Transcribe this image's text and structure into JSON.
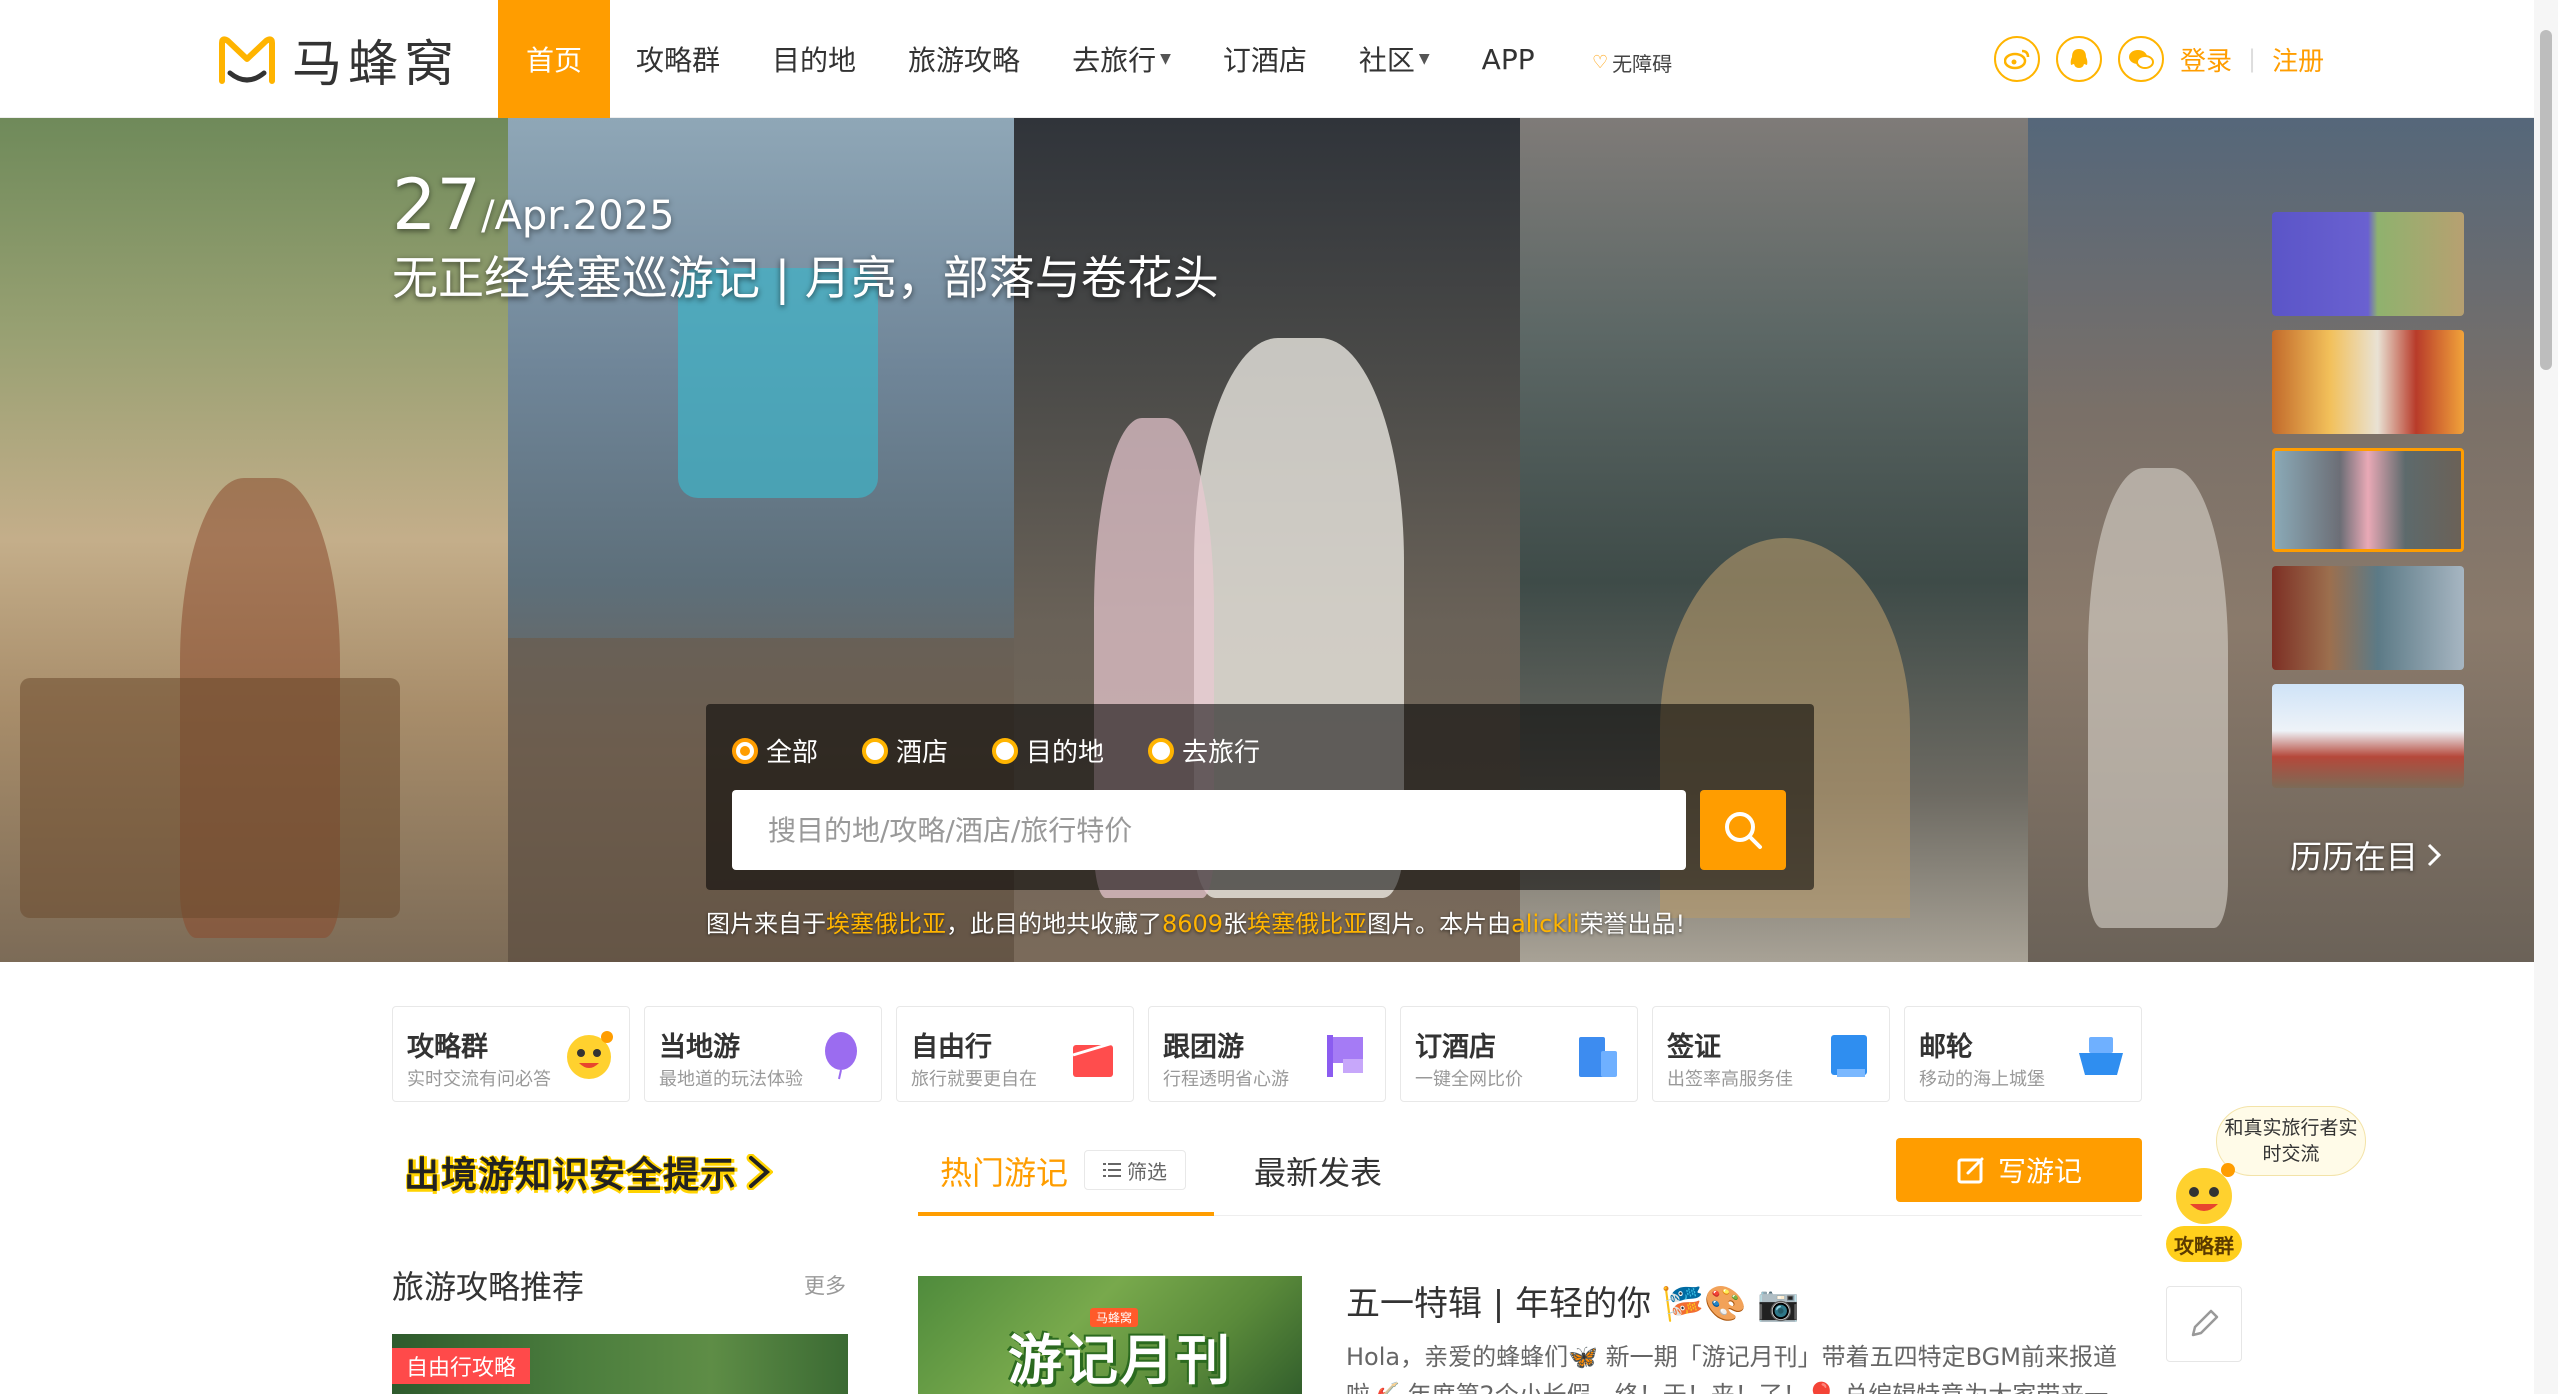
{
  "header": {
    "logo_text": "马蜂窝",
    "nav": [
      {
        "label": "首页",
        "active": true,
        "dropdown": false
      },
      {
        "label": "攻略群",
        "active": false,
        "dropdown": false
      },
      {
        "label": "目的地",
        "active": false,
        "dropdown": false
      },
      {
        "label": "旅游攻略",
        "active": false,
        "dropdown": false
      },
      {
        "label": "去旅行",
        "active": false,
        "dropdown": true
      },
      {
        "label": "订酒店",
        "active": false,
        "dropdown": false
      },
      {
        "label": "社区",
        "active": false,
        "dropdown": true
      },
      {
        "label": "APP",
        "active": false,
        "dropdown": false
      }
    ],
    "accessibility": "无障碍",
    "social_icons": [
      "weibo-icon",
      "qq-icon",
      "wechat-icon"
    ],
    "login": "登录",
    "register": "注册",
    "auth_separator": "|"
  },
  "hero": {
    "date_day": "27",
    "date_rest": "/Apr.2025",
    "title": "无正经埃塞巡游记 | 月亮，部落与卷花头",
    "search": {
      "options": [
        "全部",
        "酒店",
        "目的地",
        "去旅行"
      ],
      "selected": "全部",
      "placeholder": "搜目的地/攻略/酒店/旅行特价"
    },
    "credit": {
      "p1": "图片来自于",
      "place1": "埃塞俄比亚",
      "p2": "，此目的地共收藏了",
      "count": "8609",
      "p3": "张",
      "place2": "埃塞俄比亚",
      "p4": "图片。本片由",
      "author": "alickli",
      "p5": "荣誉出品!"
    },
    "history_link": "历历在目",
    "selected_thumb": 3
  },
  "features": [
    {
      "title": "攻略群",
      "subtitle": "实时交流有问必答",
      "icon": "mascot-icon",
      "color": "#ffd12e"
    },
    {
      "title": "当地游",
      "subtitle": "最地道的玩法体验",
      "icon": "balloon-icon",
      "color": "#9b6cf0"
    },
    {
      "title": "自由行",
      "subtitle": "旅行就要更自在",
      "icon": "gift-icon",
      "color": "#ff4d4d"
    },
    {
      "title": "跟团游",
      "subtitle": "行程透明省心游",
      "icon": "flag-icon",
      "color": "#8b5cf0"
    },
    {
      "title": "订酒店",
      "subtitle": "一键全网比价",
      "icon": "hotel-icon",
      "color": "#3d8cf0"
    },
    {
      "title": "签证",
      "subtitle": "出签率高服务佳",
      "icon": "visa-icon",
      "color": "#2f8ef0"
    },
    {
      "title": "邮轮",
      "subtitle": "移动的海上城堡",
      "icon": "ship-icon",
      "color": "#2f8ef0"
    }
  ],
  "left": {
    "safety_banner": "出境游知识安全提示",
    "recommend_title": "旅游攻略推荐",
    "recommend_more": "更多",
    "card_tag": "自由行攻略"
  },
  "tabs": {
    "hot": "热门游记",
    "filter": "筛选",
    "new": "最新发表",
    "write": "写游记"
  },
  "note": {
    "image_text": "游记月刊",
    "image_badge": "马蜂窝",
    "title": "五一特辑 | 年轻的你 🎏🎨 📷",
    "body": "Hola，亲爱的蜂蜂们🦋 新一期「游记月刊」带着五四特定BGM前来报道啦🎸 年度第2个小长假，终！于！来！了！🎈 总编辑特意为大家带来一"
  },
  "floating": {
    "bubble": "和真实旅行者实时交流",
    "label": "攻略群"
  }
}
